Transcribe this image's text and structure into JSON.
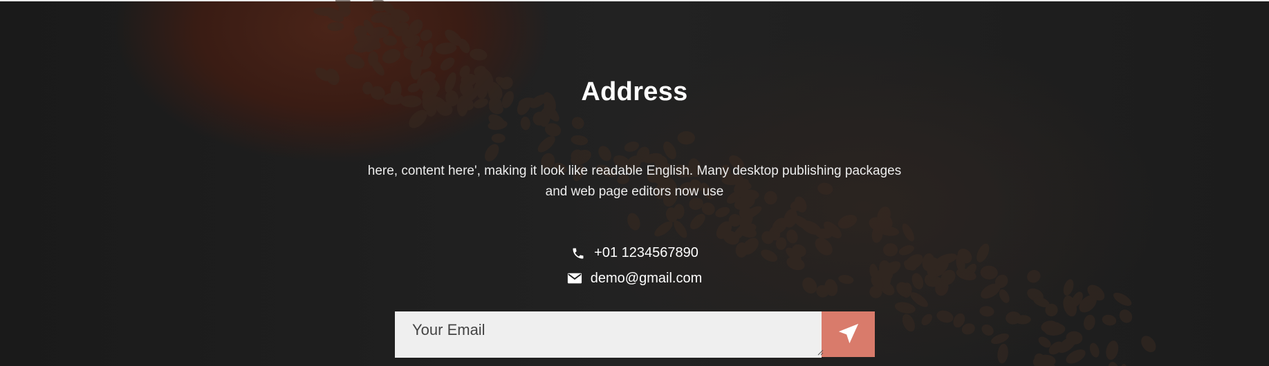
{
  "section": {
    "title": "Address",
    "description": "here, content here', making it look like readable English. Many desktop publishing packages and web page editors now use"
  },
  "contact": {
    "phone": "+01 1234567890",
    "phone_icon": "phone-icon",
    "email": "demo@gmail.com",
    "email_icon": "envelope-icon"
  },
  "newsletter": {
    "placeholder": "Your Email",
    "submit_icon": "send-icon",
    "submit_color": "#d97b6b"
  },
  "colors": {
    "background": "#1d1d1d",
    "text": "#ffffff",
    "input_bg": "#efefef"
  }
}
